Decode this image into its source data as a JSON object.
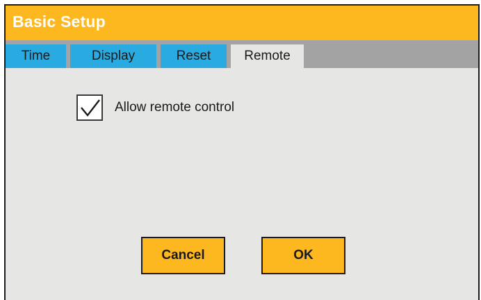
{
  "window": {
    "title": "Basic Setup"
  },
  "tabs": [
    {
      "label": "Time",
      "active": false
    },
    {
      "label": "Display",
      "active": false
    },
    {
      "label": "Reset",
      "active": false
    },
    {
      "label": "Remote",
      "active": true
    }
  ],
  "remote": {
    "allow_remote_control": {
      "label": "Allow remote control",
      "checked": true
    }
  },
  "buttons": {
    "cancel_label": "Cancel",
    "ok_label": "OK"
  },
  "colors": {
    "title_bar": "#fdb71f",
    "tab_inactive": "#29abe2",
    "tab_strip": "#a3a3a3",
    "panel": "#e6e6e4",
    "button": "#fdb71f"
  }
}
